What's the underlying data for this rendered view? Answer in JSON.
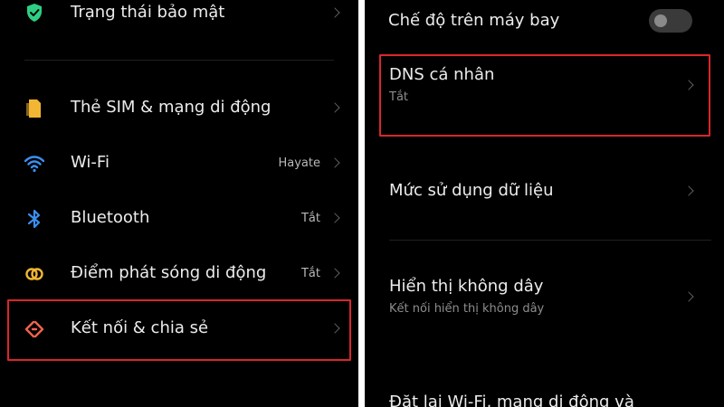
{
  "left": {
    "items": [
      {
        "label": "Trạng thái bảo mật",
        "value": "",
        "icon": "shield-check-icon",
        "color": "#2fcf83"
      },
      {
        "label": "Thẻ SIM & mạng di động",
        "value": "",
        "icon": "sim-card-icon",
        "color": "#f2b634"
      },
      {
        "label": "Wi-Fi",
        "value": "Hayate",
        "icon": "wifi-icon",
        "color": "#3b8fef"
      },
      {
        "label": "Bluetooth",
        "value": "Tắt",
        "icon": "bluetooth-icon",
        "color": "#3b8fef"
      },
      {
        "label": "Điểm phát sóng di động",
        "value": "Tắt",
        "icon": "hotspot-icon",
        "color": "#f2b634"
      },
      {
        "label": "Kết nối & chia sẻ",
        "value": "",
        "icon": "connection-sharing-icon",
        "color": "#f2624f"
      }
    ]
  },
  "right": {
    "airplane": {
      "label": "Chế độ trên máy bay",
      "on": false
    },
    "dns": {
      "label": "DNS cá nhân",
      "sub": "Tắt"
    },
    "data_usage": {
      "label": "Mức sử dụng dữ liệu"
    },
    "wireless_display": {
      "label": "Hiển thị không dây",
      "sub": "Kết nối hiển thị không dây"
    },
    "reset": {
      "label": "Đặt lại Wi-Fi, mạng di động và"
    }
  },
  "highlight_color": "#d9262c"
}
